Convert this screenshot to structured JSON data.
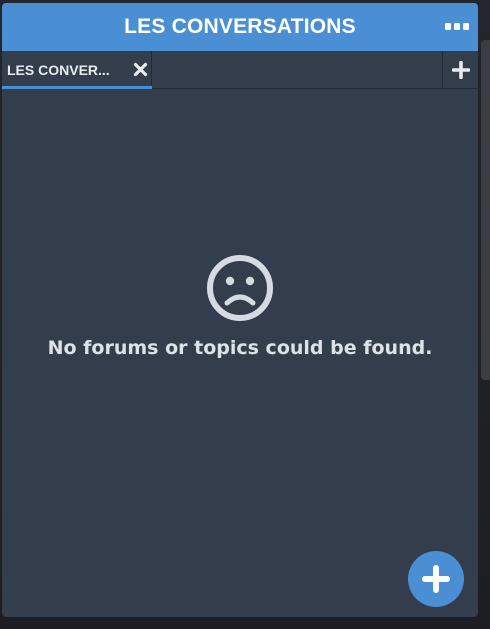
{
  "window": {
    "title": "LES CONVERSATIONS"
  },
  "tabs": [
    {
      "label": "LES CONVER...",
      "active": true
    }
  ],
  "empty_state": {
    "icon": "sad-face-icon",
    "message": "No forums or topics could be found."
  },
  "icons": {
    "menu": "more-horizontal-icon",
    "close": "close-icon",
    "add_tab": "plus-icon",
    "fab": "plus-icon"
  },
  "colors": {
    "accent": "#4a8fd3",
    "panel": "#333d4b",
    "text": "#dde2e8"
  }
}
